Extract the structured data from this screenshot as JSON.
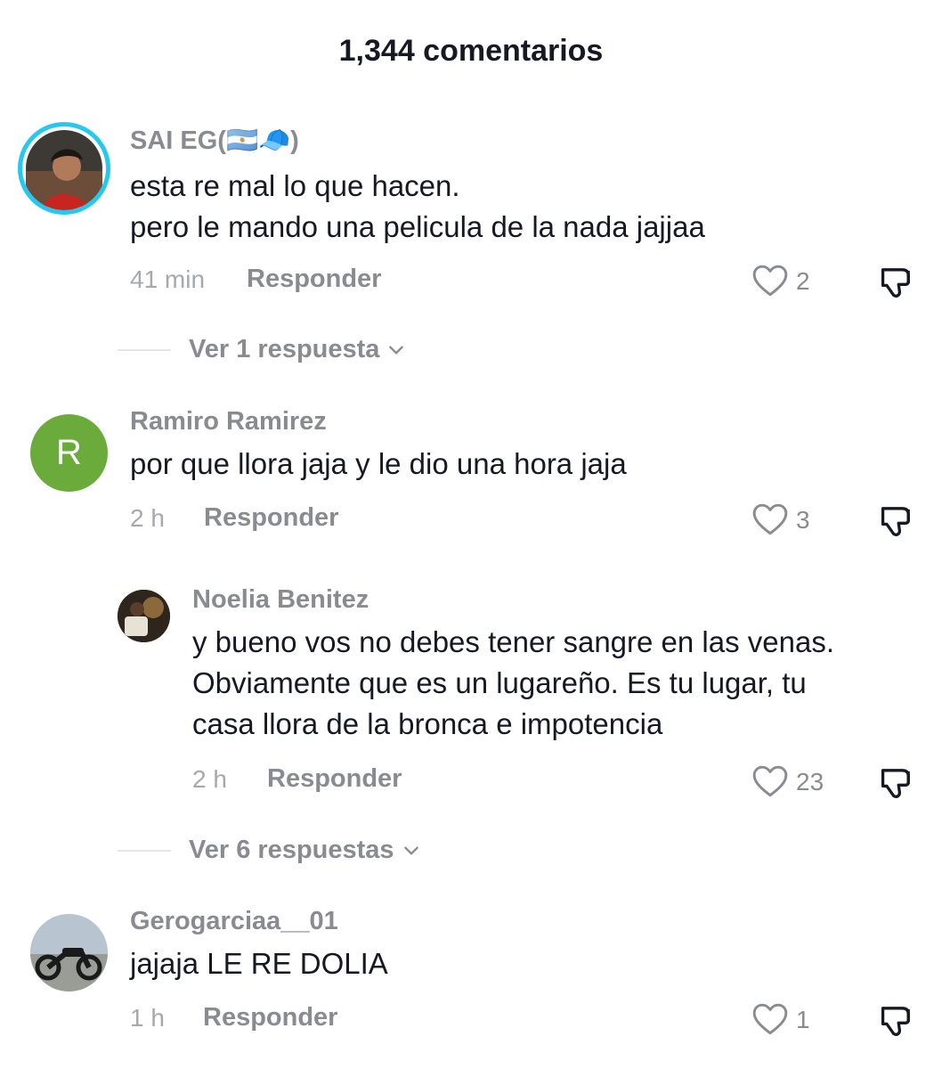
{
  "header": {
    "title": "1,344 comentarios"
  },
  "comments": [
    {
      "username": "SAI EG(🇦🇷🧢)",
      "lines": [
        "esta re mal lo que hacen.",
        "pero le mando una pelicula de la nada jajjaa"
      ],
      "time": "41 min",
      "reply_label": "Responder",
      "likes": "2"
    },
    {
      "username": "Ramiro Ramirez",
      "avatar_letter": "R",
      "lines": [
        "por que llora jaja y le dio una hora jaja"
      ],
      "time": "2 h",
      "reply_label": "Responder",
      "likes": "3"
    },
    {
      "username": "Noelia Benitez",
      "lines": [
        "y bueno vos no debes tener sangre en las venas.",
        "Obviamente que es un lugareño. Es tu lugar, tu",
        "casa llora de la bronca e impotencia"
      ],
      "time": "2 h",
      "reply_label": "Responder",
      "likes": "23"
    },
    {
      "username": "Gerogarciaa__01",
      "lines": [
        "jajaja LE RE DOLIA"
      ],
      "time": "1 h",
      "reply_label": "Responder",
      "likes": "1"
    }
  ],
  "view_replies": [
    {
      "label": "Ver 1 respuesta"
    },
    {
      "label": "Ver 6 respuestas"
    }
  ],
  "colors": {
    "avatar_ring": "#25c9ef",
    "avatar_letter_bg": "#6aab3c",
    "muted_text": "#8a8b91"
  },
  "icons": {
    "like": "heart-outline-icon",
    "dislike": "thumbs-down-outline-icon",
    "expand": "chevron-down-icon"
  }
}
